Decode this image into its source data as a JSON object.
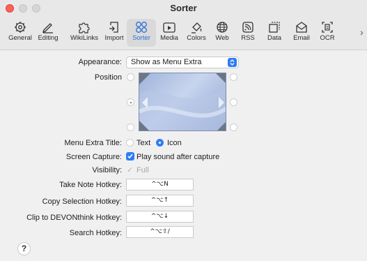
{
  "window": {
    "title": "Sorter"
  },
  "toolbar": {
    "items": [
      {
        "label": "General",
        "icon": "gear-icon"
      },
      {
        "label": "Editing",
        "icon": "pencil-icon"
      },
      {
        "label": "WikiLinks",
        "icon": "puzzle-icon"
      },
      {
        "label": "Import",
        "icon": "import-icon"
      },
      {
        "label": "Sorter",
        "icon": "sorter-icon"
      },
      {
        "label": "Media",
        "icon": "media-icon"
      },
      {
        "label": "Colors",
        "icon": "paint-bucket-icon"
      },
      {
        "label": "Web",
        "icon": "globe-icon"
      },
      {
        "label": "RSS",
        "icon": "rss-icon"
      },
      {
        "label": "Data",
        "icon": "data-icon"
      },
      {
        "label": "Email",
        "icon": "envelope-icon"
      },
      {
        "label": "OCR",
        "icon": "ocr-icon"
      }
    ],
    "selected": "Sorter",
    "overflow": "›"
  },
  "form": {
    "appearance_label": "Appearance:",
    "appearance_value": "Show as Menu Extra",
    "position_label": "Position",
    "menu_extra_title_label": "Menu Extra Title:",
    "menu_extra_options": [
      "Text",
      "Icon"
    ],
    "menu_extra_selected": "Icon",
    "screen_capture_label": "Screen Capture:",
    "screen_capture_option": "Play sound after capture",
    "screen_capture_checked": true,
    "visibility_label": "Visibility:",
    "visibility_option": "Full",
    "hotkeys": [
      {
        "label": "Take Note Hotkey:",
        "value": "^⌥N"
      },
      {
        "label": "Copy Selection Hotkey:",
        "value": "^⌥↑"
      },
      {
        "label": "Clip to DEVONthink Hotkey:",
        "value": "^⌥↓"
      },
      {
        "label": "Search Hotkey:",
        "value": "^⌥⇧/"
      }
    ],
    "help": "?"
  },
  "colors": {
    "accent": "#2f7cf6",
    "close": "#fe5f57"
  }
}
